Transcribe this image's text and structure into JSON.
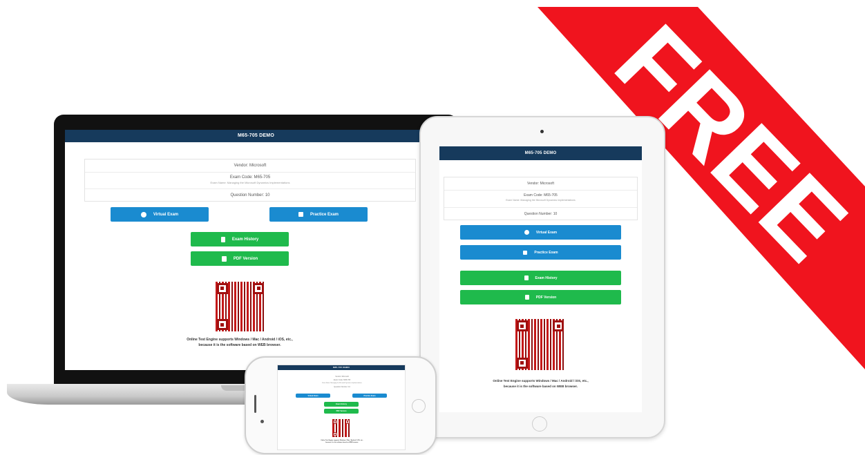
{
  "banner": {
    "label": "FREE",
    "color": "#f0141e"
  },
  "demo": {
    "title": "M65-705 DEMO",
    "version": "Vendor: Microsoft",
    "exam_code": "Exam Code: M65-705",
    "exam_name": "Exam Name: Managing the Microsoft Dynamics Implementations",
    "question_number": "Question Number: 10",
    "buttons": {
      "virtual_exam": "Virtual Exam",
      "practice_exam": "Practice Exam",
      "exam_history": "Exam History",
      "pdf_version": "PDF Version"
    },
    "caption_line1": "Online Test Engine supports Windows / Mac / Android / iOS, etc.,",
    "caption_line2": "because it is the software based on WEB browser."
  },
  "colors": {
    "header": "#163a5c",
    "blue_button": "#1a8bd0",
    "green_button": "#1fba4c"
  }
}
